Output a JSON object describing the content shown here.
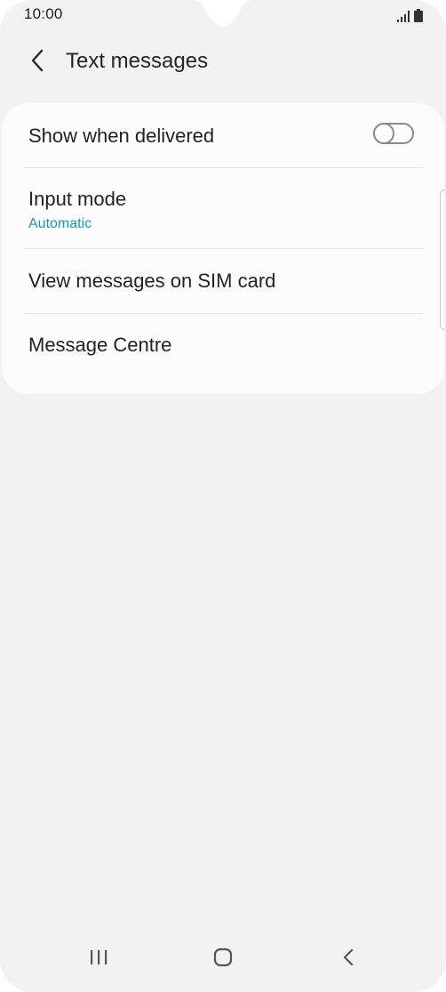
{
  "status_bar": {
    "time": "10:00",
    "icons": [
      "signal-icon",
      "battery-icon"
    ]
  },
  "header": {
    "back_icon": "chevron-left-icon",
    "title": "Text messages"
  },
  "settings": {
    "show_when_delivered": {
      "label": "Show when delivered",
      "toggle_on": false
    },
    "input_mode": {
      "label": "Input mode",
      "value": "Automatic"
    },
    "view_sim_messages": {
      "label": "View messages on SIM card"
    },
    "message_centre": {
      "label": "Message Centre"
    }
  },
  "nav_bar": {
    "icons": [
      "recent-apps-icon",
      "home-icon",
      "back-icon"
    ]
  },
  "colors": {
    "background": "#f2f2f2",
    "card": "#fcfcfc",
    "accent": "#1994b8",
    "text": "#222222"
  }
}
